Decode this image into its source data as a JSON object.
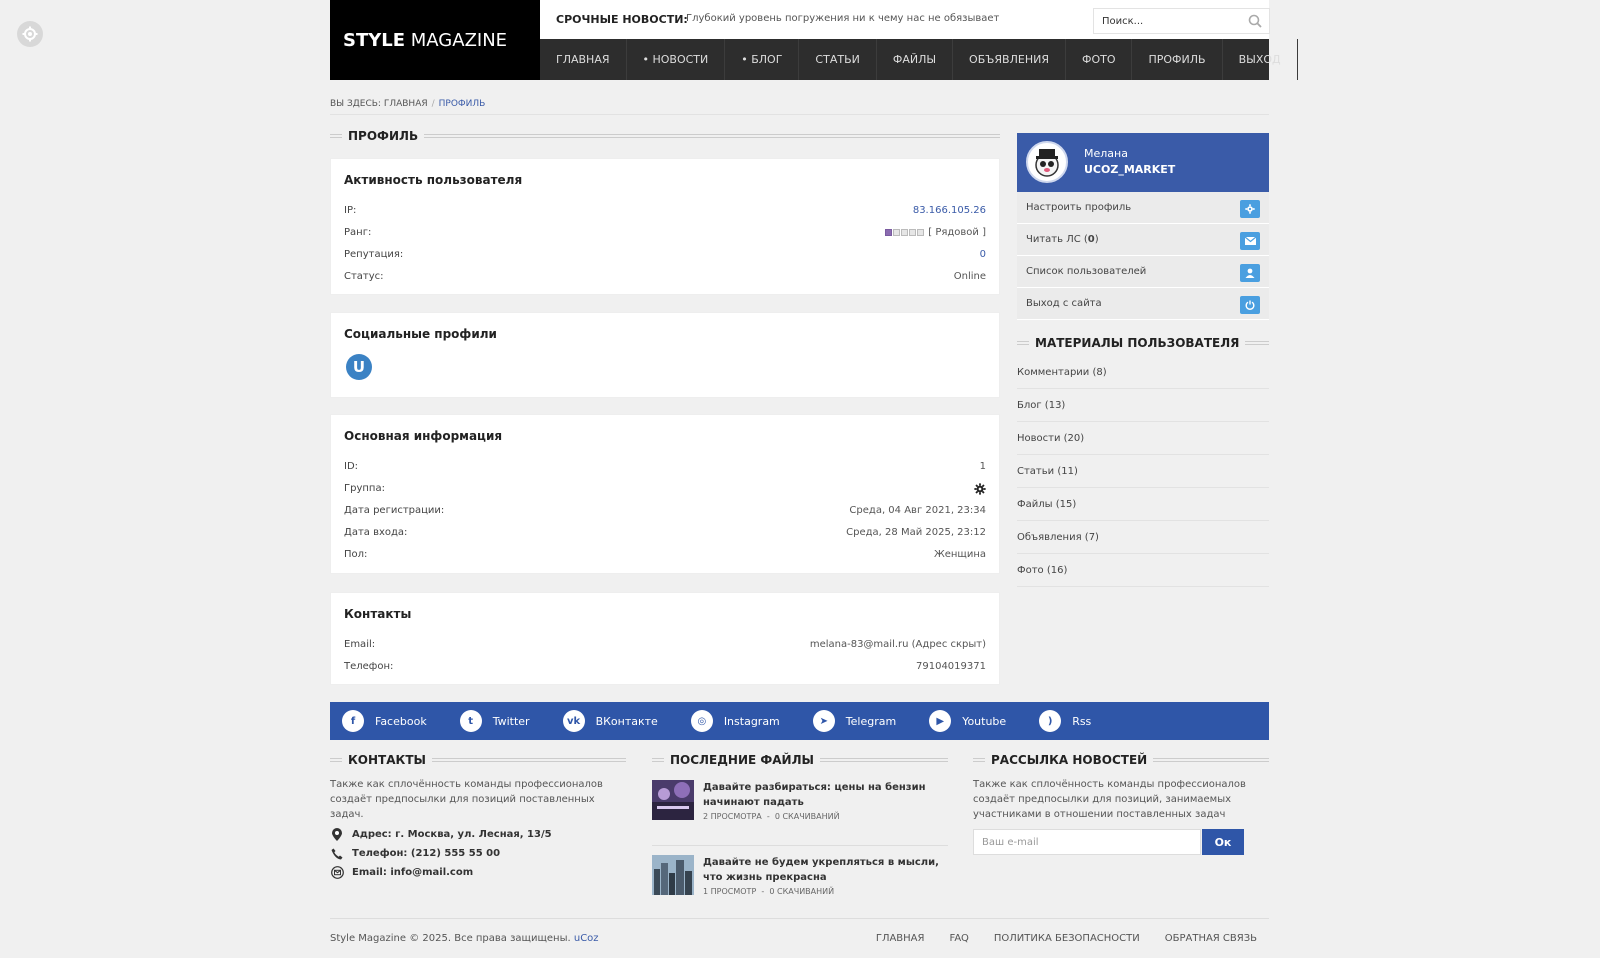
{
  "header": {
    "logo_bold": "STYLE",
    "logo_light": "MAGAZINE",
    "breaking_label": "СРОЧНЫЕ НОВОСТИ:",
    "breaking_text": "Глубокий уровень погружения ни к чему нас не обязывает",
    "search_placeholder": "Поиск..."
  },
  "nav": [
    "ГЛАВНАЯ",
    "• НОВОСТИ",
    "• БЛОГ",
    "СТАТЬИ",
    "ФАЙЛЫ",
    "ОБЪЯВЛЕНИЯ",
    "ФОТО",
    "ПРОФИЛЬ",
    "ВЫХОД"
  ],
  "breadcrumb": {
    "prefix": "ВЫ ЗДЕСЬ:",
    "home": "ГЛАВНАЯ",
    "sep": "/",
    "current": "ПРОФИЛЬ"
  },
  "profile": {
    "heading": "ПРОФИЛЬ",
    "activity": {
      "title": "Активность пользователя",
      "ip_label": "IP:",
      "ip_value": "83.166.105.26",
      "rank_label": "Ранг:",
      "rank_value": "[ Рядовой ]",
      "reputation_label": "Репутация:",
      "reputation_value": "0",
      "status_label": "Статус:",
      "status_value": "Online"
    },
    "social": {
      "title": "Социальные профили",
      "badge": "U"
    },
    "basic": {
      "title": "Основная информация",
      "id_label": "ID:",
      "id_value": "1",
      "group_label": "Группа:",
      "reg_label": "Дата регистрации:",
      "reg_value": "Среда, 04 Авг 2021, 23:34",
      "login_label": "Дата входа:",
      "login_value": "Среда, 28 Май 2025, 23:12",
      "gender_label": "Пол:",
      "gender_value": "Женщина"
    },
    "contacts": {
      "title": "Контакты",
      "email_label": "Email:",
      "email_value": "melana-83@mail.ru (Адрес скрыт)",
      "phone_label": "Телефон:",
      "phone_value": "79104019371"
    }
  },
  "sidebar": {
    "user_name": "Мелана",
    "user_login": "UCOZ_MARKET",
    "menu": [
      "Настроить профиль",
      "Список пользователей",
      "Выход с сайта"
    ],
    "messages_prefix": "Читать ЛС (",
    "messages_count": "0",
    "messages_suffix": ")",
    "materials_heading": "МАТЕРИАЛЫ ПОЛЬЗОВАТЕЛЯ",
    "materials": [
      "Комментарии (8)",
      "Блог (13)",
      "Новости (20)",
      "Статьи (11)",
      "Файлы (15)",
      "Объявления (7)",
      "Фото (16)"
    ]
  },
  "social_bar": [
    "Facebook",
    "Twitter",
    "ВКонтакте",
    "Instagram",
    "Telegram",
    "Youtube",
    "Rss"
  ],
  "footer": {
    "contacts_heading": "КОНТАКТЫ",
    "contacts_text": "Также как сплочённость команды профессионалов создаёт предпосылки для позиций поставленных задач.",
    "address": "Адрес: г. Москва, ул. Лесная, 13/5",
    "phone": "Телефон: (212) 555 55 00",
    "email": "Email: info@mail.com",
    "files_heading": "ПОСЛЕДНИЕ ФАЙЛЫ",
    "files": [
      {
        "title": "Давайте разбираться: цены на бензин начинают падать",
        "views": "2 ПРОСМОТРА",
        "downloads": "0 СКАЧИВАНИЙ"
      },
      {
        "title": "Давайте не будем укрепляться в мысли, что жизнь прекрасна",
        "views": "1 ПРОСМОТР",
        "downloads": "0 СКАЧИВАНИЙ"
      }
    ],
    "meta_sep": "-",
    "newsletter_heading": "РАССЫЛКА НОВОСТЕЙ",
    "newsletter_text": "Также как сплочённость команды профессионалов создаёт предпосылки для позиций, занимаемых участниками в отношении поставленных задач",
    "email_placeholder": "Ваш e-mail",
    "submit": "Ок"
  },
  "bottom": {
    "copyright": "Style Magazine © 2025. Все права защищены.",
    "ucoz": "uCoz",
    "links": [
      "ГЛАВНАЯ",
      "FAQ",
      "ПОЛИТИКА БЕЗОПАСНОСТИ",
      "ОБРАТНАЯ СВЯЗЬ"
    ]
  }
}
